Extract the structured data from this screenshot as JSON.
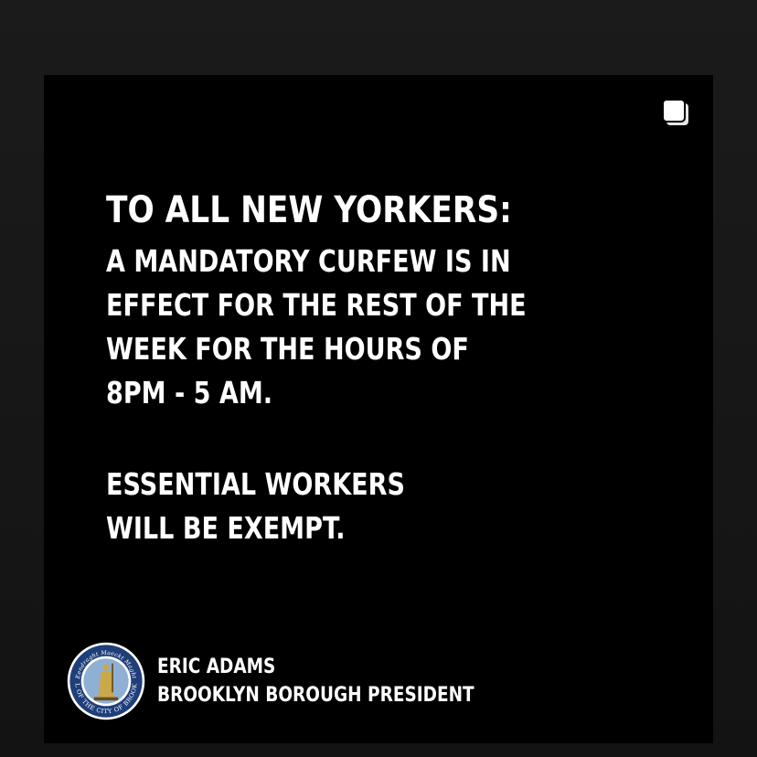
{
  "post": {
    "headline": "TO ALL NEW YORKERS:",
    "body_lines": [
      "A MANDATORY CURFEW IS IN",
      "EFFECT FOR THE REST OF THE",
      "WEEK FOR THE HOURS OF",
      "8PM - 5 AM."
    ],
    "exempt_lines": [
      "ESSENTIAL WORKERS",
      "WILL BE EXEMPT."
    ]
  },
  "footer": {
    "name": "ERIC ADAMS",
    "title": "BROOKLYN BOROUGH PRESIDENT",
    "seal_text_top": "Eendraght Maeckt Maght",
    "seal_text_bottom": "SEAL OF THE CITY OF BROOKLYN"
  },
  "icons": {
    "multi_post": "multiple-images-icon",
    "seal": "brooklyn-seal-icon"
  },
  "colors": {
    "background": "#000000",
    "text": "#ffffff",
    "seal_ring": "#1f3f7a",
    "seal_gold": "#c9a94a"
  }
}
